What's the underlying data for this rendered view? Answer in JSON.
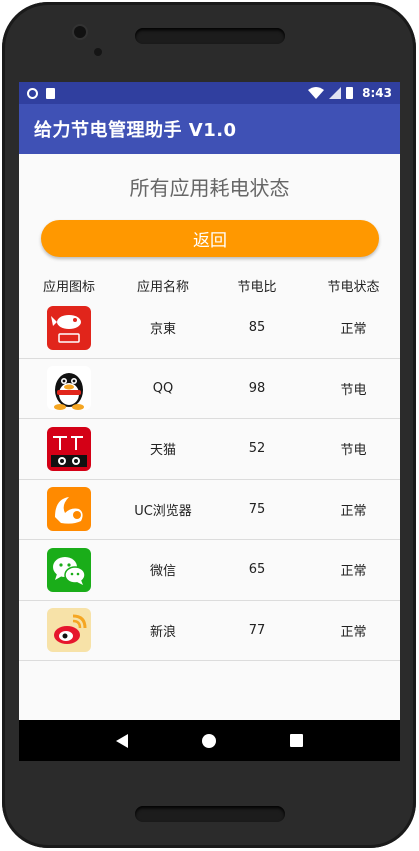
{
  "statusbar": {
    "time": "8:43"
  },
  "appbar": {
    "title": "给力节电管理助手 V1.0"
  },
  "page": {
    "title": "所有应用耗电状态",
    "back_label": "返回"
  },
  "table": {
    "headers": [
      "应用图标",
      "应用名称",
      "节电比",
      "节电状态"
    ],
    "rows": [
      {
        "icon": "jd-icon",
        "name": "京東",
        "ratio": "85",
        "status": "正常"
      },
      {
        "icon": "qq-icon",
        "name": "QQ",
        "ratio": "98",
        "status": "节电"
      },
      {
        "icon": "tmall-icon",
        "name": "天猫",
        "ratio": "52",
        "status": "节电"
      },
      {
        "icon": "uc-browser-icon",
        "name": "UC浏览器",
        "ratio": "75",
        "status": "正常"
      },
      {
        "icon": "wechat-icon",
        "name": "微信",
        "ratio": "65",
        "status": "正常"
      },
      {
        "icon": "weibo-icon",
        "name": "新浪",
        "ratio": "77",
        "status": "正常"
      }
    ]
  },
  "colors": {
    "statusbar": "#303f9f",
    "appbar": "#3f51b5",
    "accent": "#ff9800"
  }
}
